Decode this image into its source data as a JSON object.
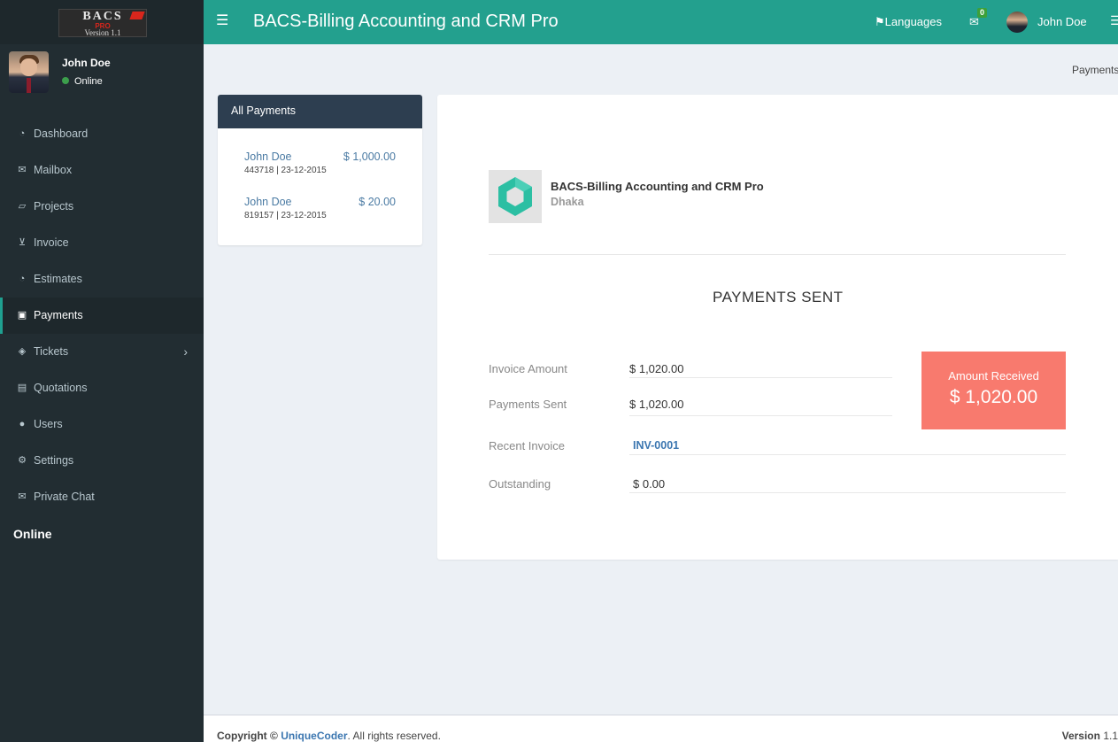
{
  "brand": {
    "logo_text": "BACS",
    "logo_sub": "PRO",
    "logo_version": "Version 1.1"
  },
  "user": {
    "name": "John Doe",
    "status": "Online"
  },
  "sidebar": {
    "items": [
      {
        "label": "Dashboard",
        "icon": "dashboard-icon"
      },
      {
        "label": "Mailbox",
        "icon": "envelope-icon"
      },
      {
        "label": "Projects",
        "icon": "folder-open-icon"
      },
      {
        "label": "Invoice",
        "icon": "cart-icon"
      },
      {
        "label": "Estimates",
        "icon": "dashboard-icon"
      },
      {
        "label": "Payments",
        "icon": "money-icon"
      },
      {
        "label": "Tickets",
        "icon": "ticket-icon"
      },
      {
        "label": "Quotations",
        "icon": "files-icon"
      },
      {
        "label": "Users",
        "icon": "users-icon"
      },
      {
        "label": "Settings",
        "icon": "gears-icon"
      },
      {
        "label": "Private Chat",
        "icon": "envelope-icon"
      }
    ],
    "online_label": "Online"
  },
  "header": {
    "title": "BACS-Billing Accounting and CRM Pro",
    "languages": "Languages",
    "mail_count": "0",
    "user_name": "John Doe"
  },
  "breadcrumb": "Payments",
  "payments_list": {
    "title": "All Payments",
    "items": [
      {
        "name": "John Doe",
        "amount": "$ 1,000.00",
        "meta": "443718 | 23-12-2015"
      },
      {
        "name": "John Doe",
        "amount": "$ 20.00",
        "meta": "819157 | 23-12-2015"
      }
    ]
  },
  "detail": {
    "company": "BACS-Billing Accounting and CRM Pro",
    "city": "Dhaka",
    "heading": "PAYMENTS SENT",
    "invoice_amount_label": "Invoice Amount",
    "invoice_amount": "$ 1,020.00",
    "payments_sent_label": "Payments Sent",
    "payments_sent": "$ 1,020.00",
    "recent_invoice_label": "Recent Invoice",
    "recent_invoice": "INV-0001",
    "outstanding_label": "Outstanding",
    "outstanding": "$ 0.00",
    "amount_received_label": "Amount Received",
    "amount_received": "$ 1,020.00"
  },
  "footer": {
    "copyright_prefix": "Copyright ©",
    "company_link": "UniqueCoder",
    "rights": ". All rights reserved.",
    "version_label": "Version",
    "version": "1.1"
  },
  "colors": {
    "header": "#23a08e",
    "sidebar": "#222d32",
    "accent_box": "#f87a6e",
    "list_head": "#2d3e50"
  }
}
